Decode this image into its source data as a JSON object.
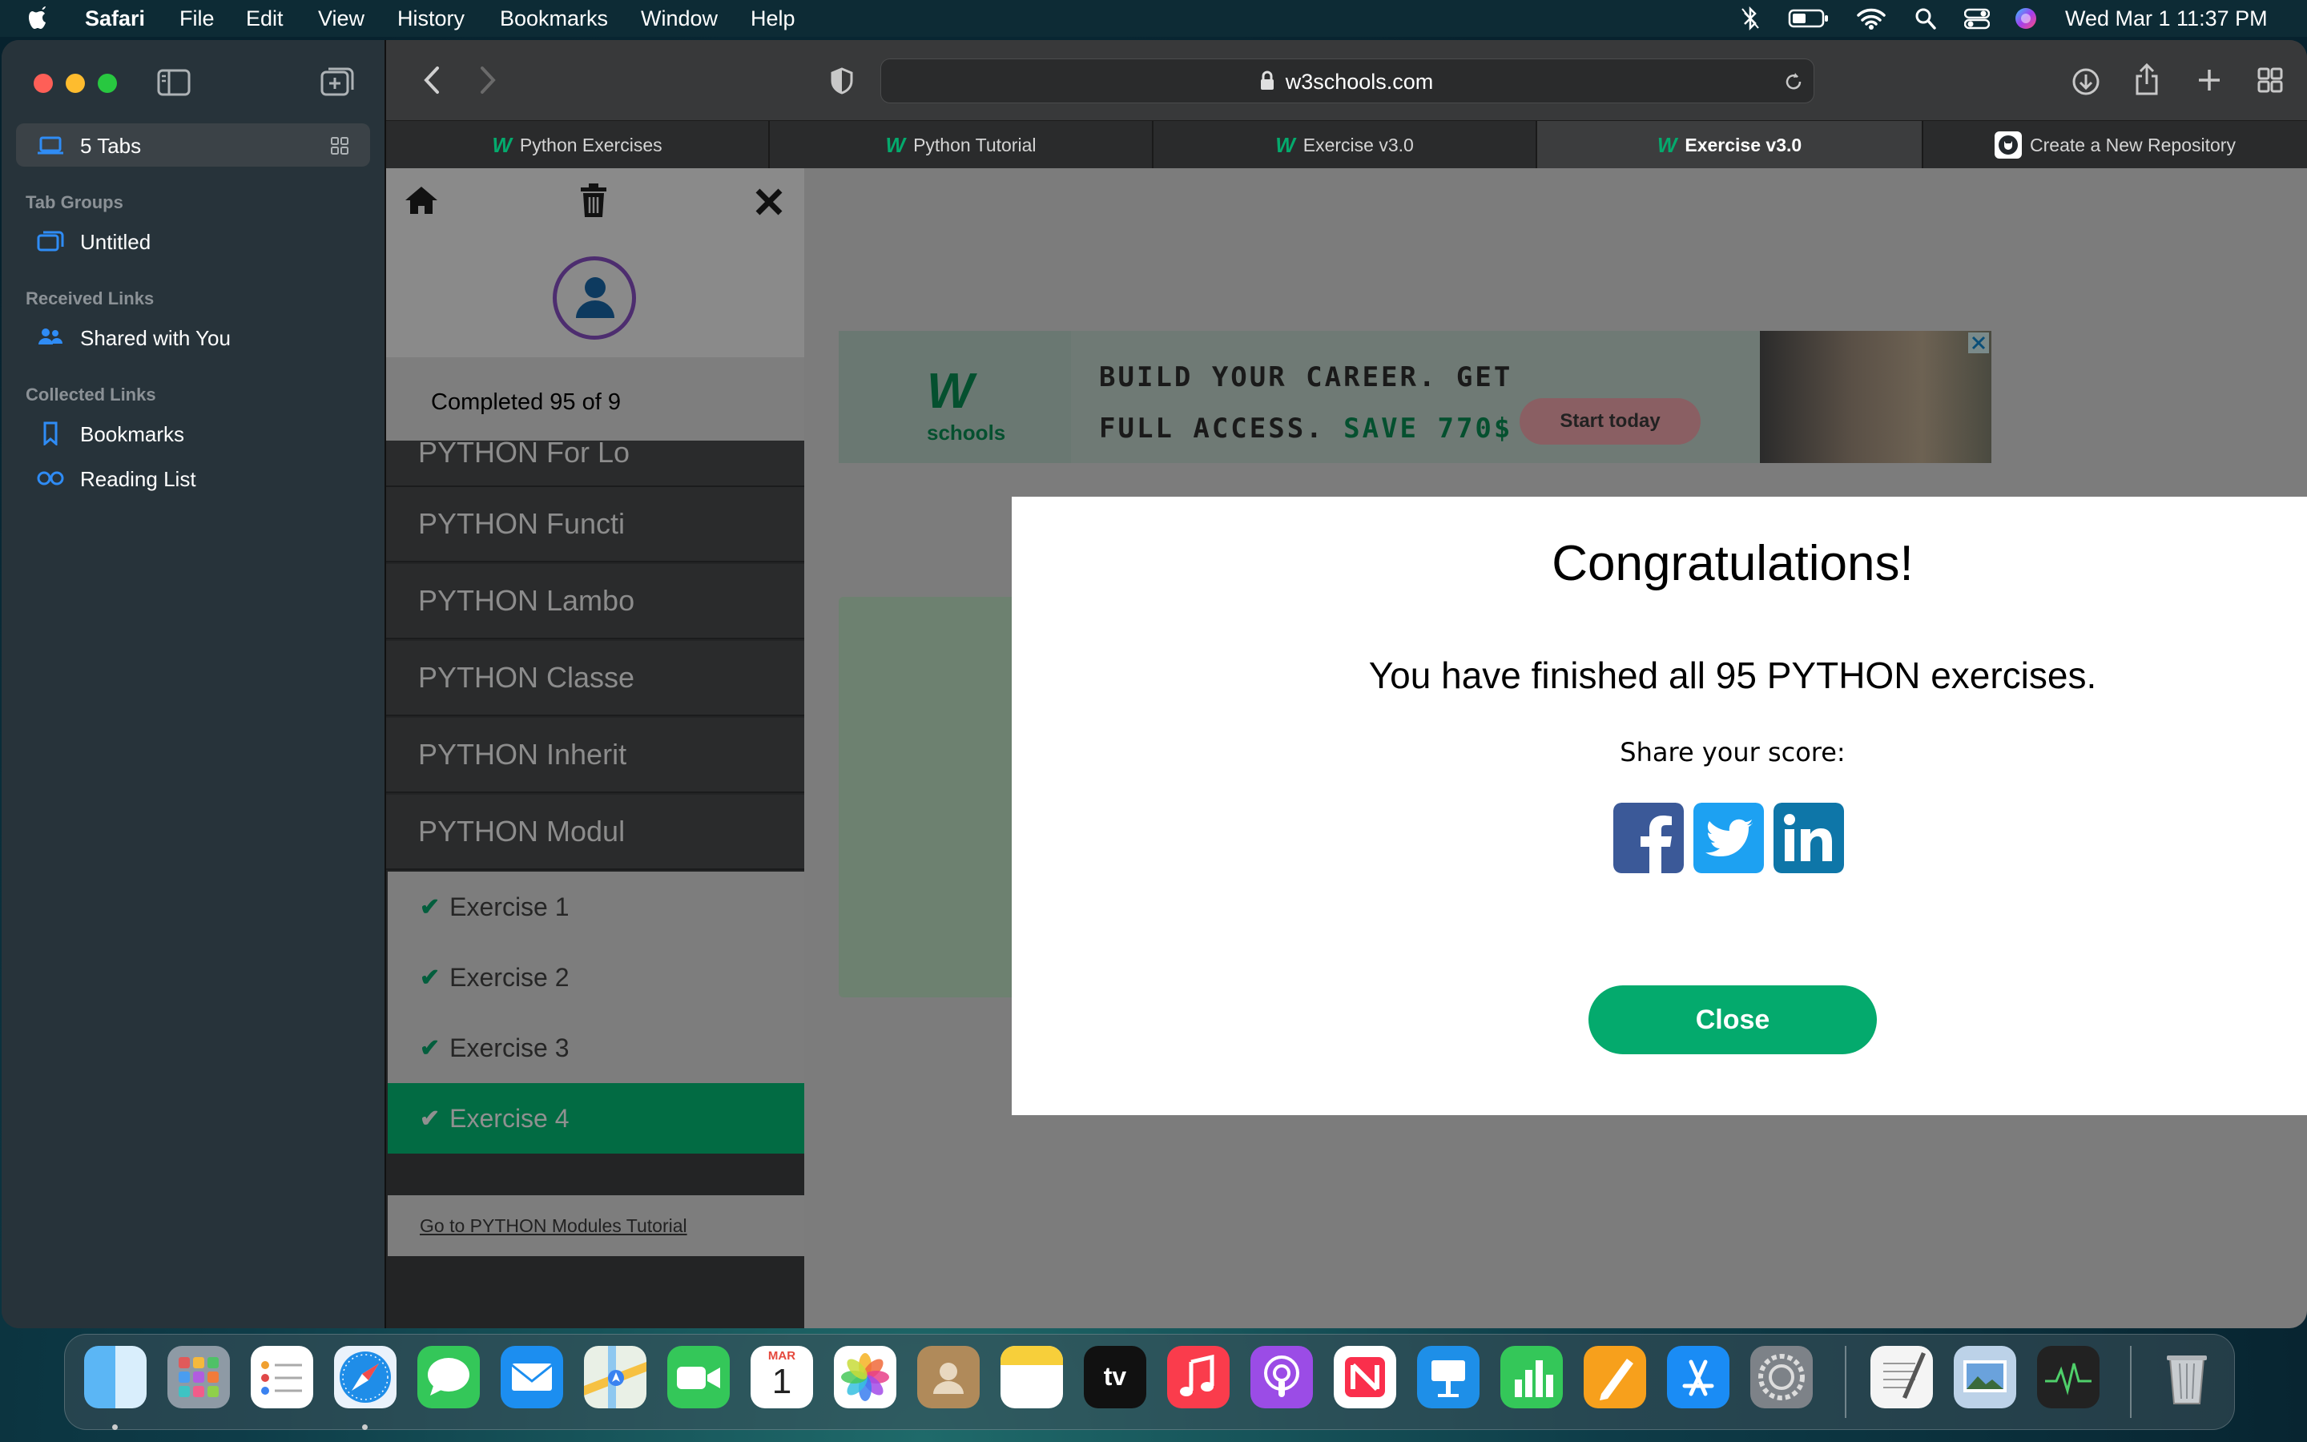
{
  "menubar": {
    "app": "Safari",
    "items": [
      "File",
      "Edit",
      "View",
      "History",
      "Bookmarks",
      "Window",
      "Help"
    ],
    "clock": "Wed Mar 1  11:37 PM"
  },
  "sidebar": {
    "tabs_label": "5 Tabs",
    "tab_groups_header": "Tab Groups",
    "untitled": "Untitled",
    "received_header": "Received Links",
    "shared": "Shared with You",
    "collected_header": "Collected Links",
    "bookmarks": "Bookmarks",
    "reading_list": "Reading List"
  },
  "toolbar": {
    "url": "w3schools.com"
  },
  "tabs": [
    {
      "label": "Python Exercises",
      "active": false
    },
    {
      "label": "Python Tutorial",
      "active": false
    },
    {
      "label": "Exercise v3.0",
      "active": false
    },
    {
      "label": "Exercise v3.0",
      "active": true
    },
    {
      "label": "Create a New Repository",
      "active": false
    }
  ],
  "left_panel": {
    "completed": "Completed 95 of 9",
    "items": [
      "PYTHON For Lo",
      "PYTHON Functi",
      "PYTHON Lambo",
      "PYTHON Classe",
      "PYTHON Inherit",
      "PYTHON Modul"
    ],
    "exercises": [
      "Exercise 1",
      "Exercise 2",
      "Exercise 3",
      "Exercise 4"
    ],
    "active_exercise": "Exercise 4",
    "tutorial_link": "Go to PYTHON Modules Tutorial"
  },
  "banner": {
    "brand": "schools",
    "line1": "BUILD YOUR CAREER. GET",
    "line2": "FULL ACCESS.",
    "save": "SAVE 770$",
    "cta": "Start today"
  },
  "modal": {
    "title": "Congratulations!",
    "message": "You have finished all 95 PYTHON exercises.",
    "share": "Share your score:",
    "close": "Close",
    "x": "×"
  },
  "dock": {
    "calendar_month": "MAR",
    "calendar_day": "1",
    "tv_label": "tv"
  },
  "colors": {
    "accent_green": "#04aa6d",
    "facebook": "#3b5998",
    "twitter": "#1da1f2",
    "linkedin": "#0e76a8"
  }
}
